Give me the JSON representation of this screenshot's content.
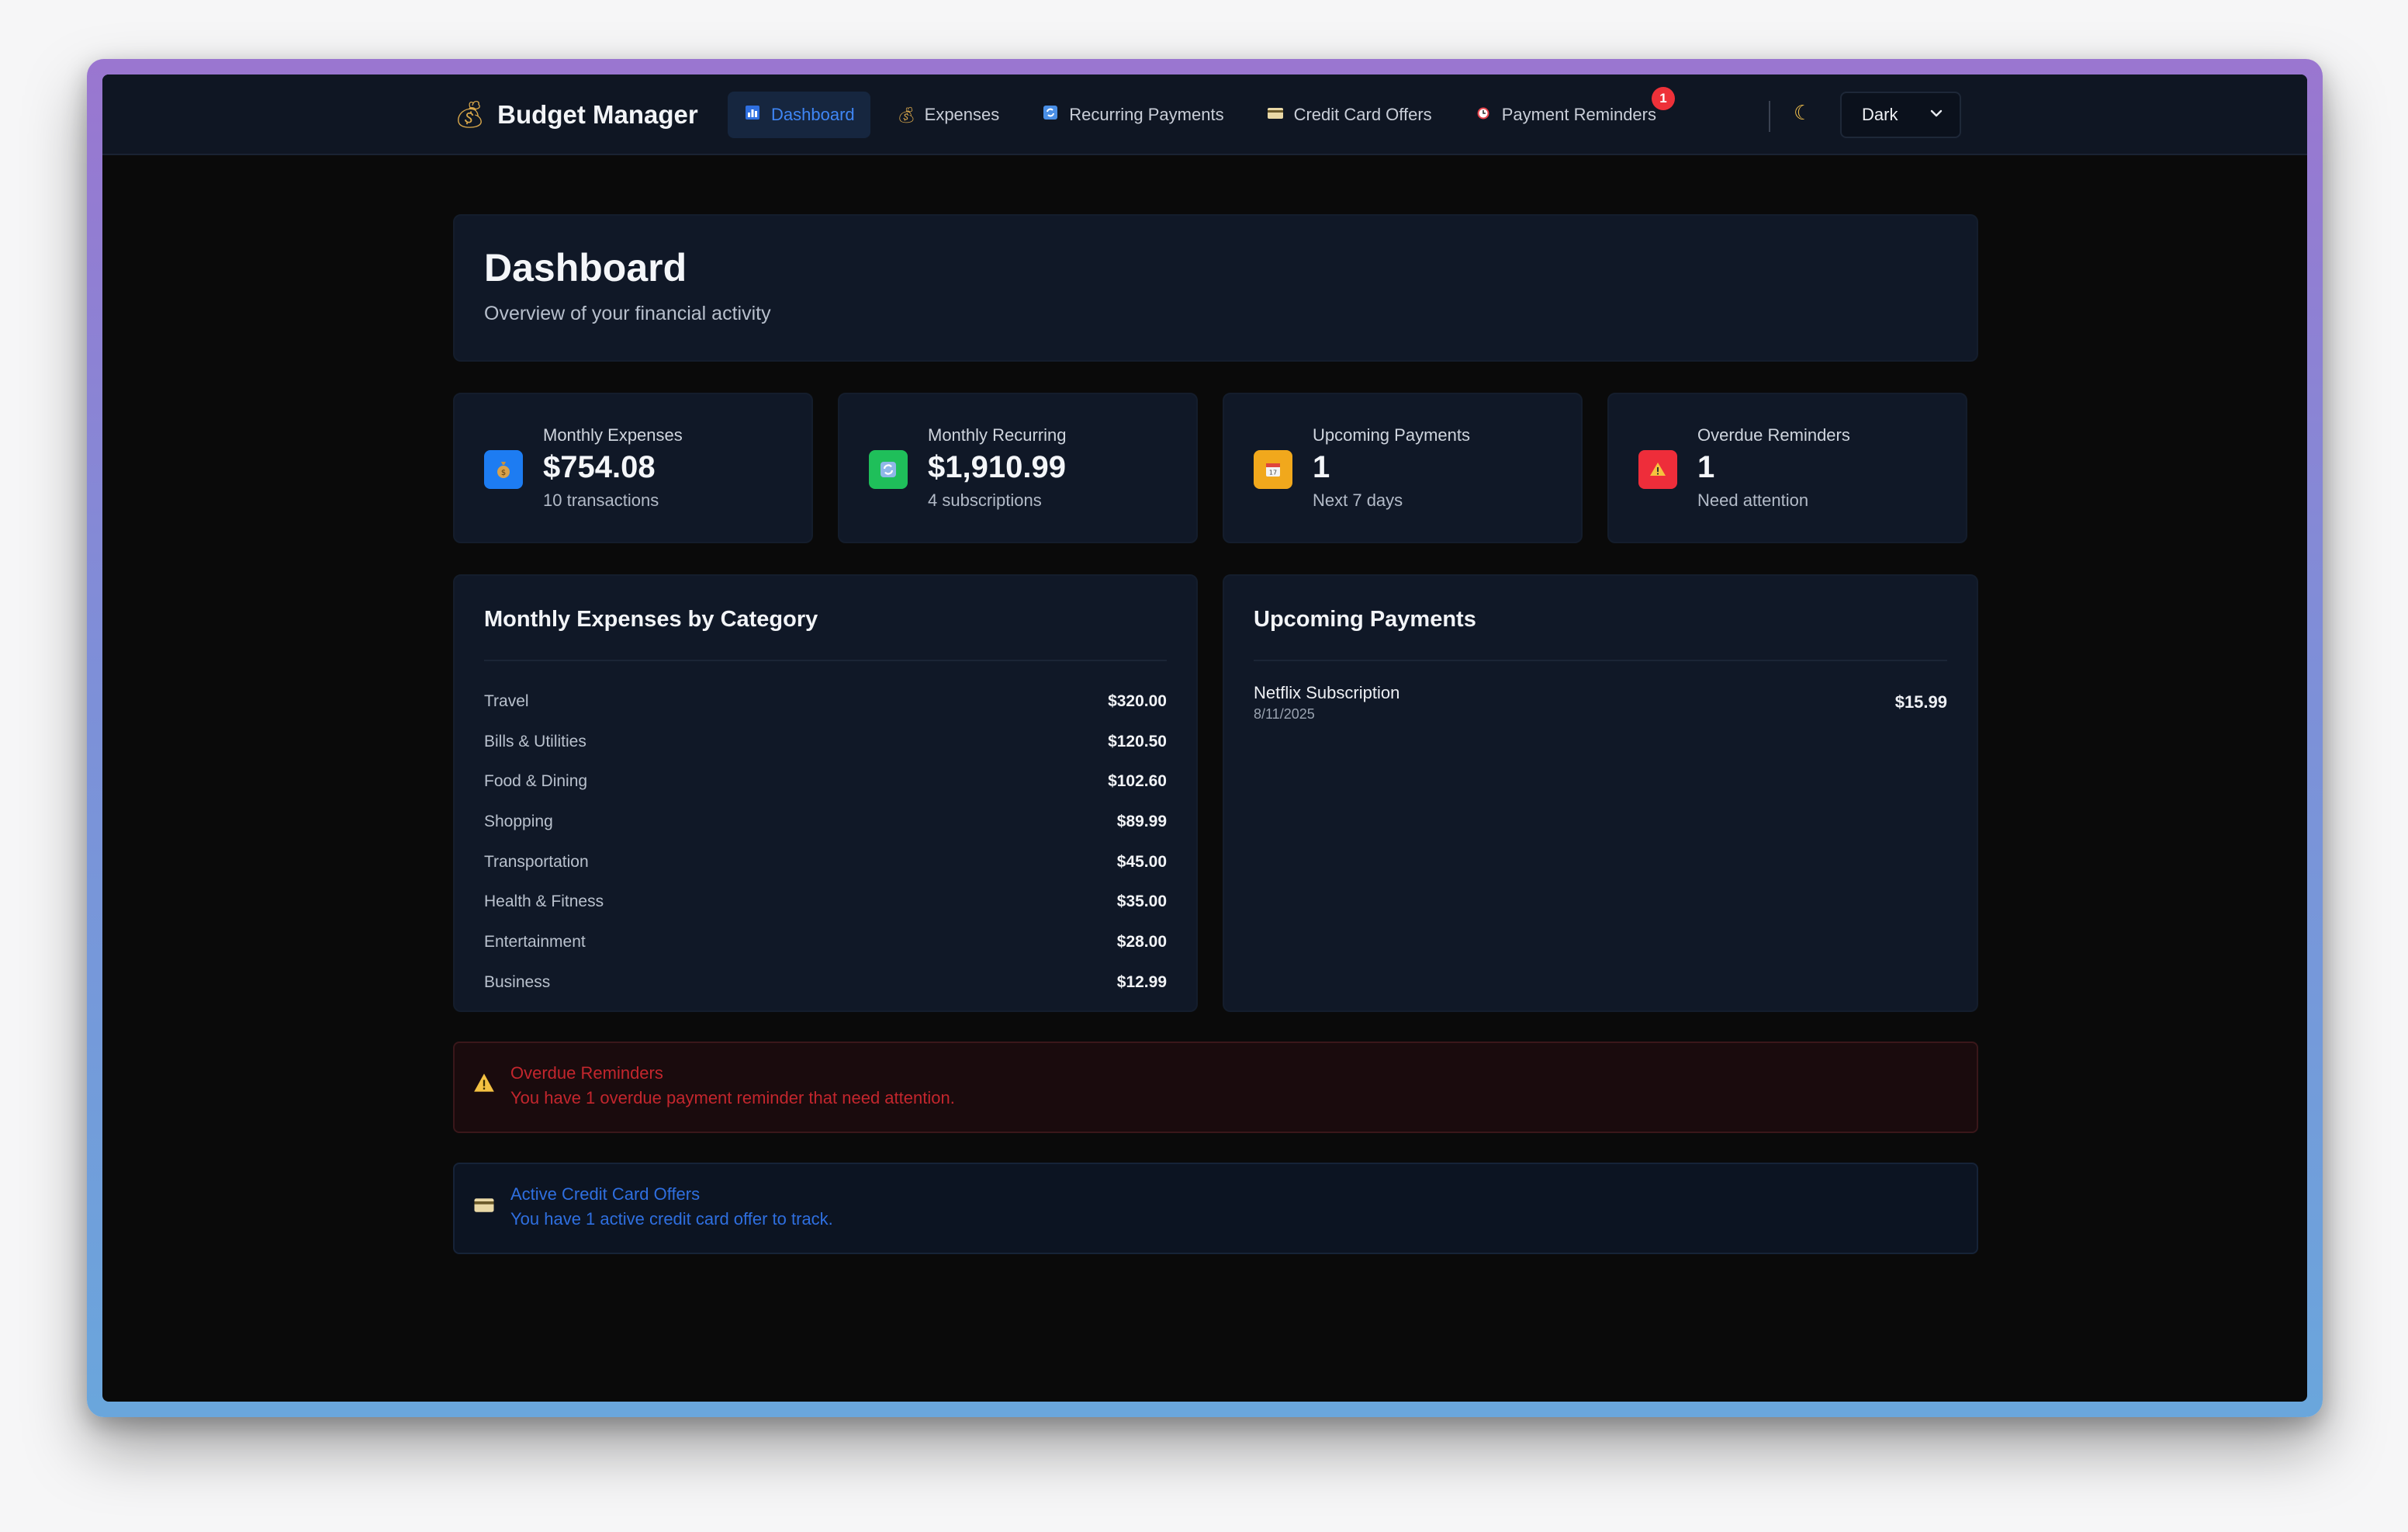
{
  "app": {
    "title": "Budget Manager",
    "icon": "money-bag-icon"
  },
  "nav": {
    "items": [
      {
        "label": "Dashboard",
        "icon": "chart-icon",
        "active": true
      },
      {
        "label": "Expenses",
        "icon": "money-bag-icon"
      },
      {
        "label": "Recurring Payments",
        "icon": "repeat-icon"
      },
      {
        "label": "Credit Card Offers",
        "icon": "credit-card-icon"
      },
      {
        "label": "Payment Reminders",
        "icon": "alarm-clock-icon",
        "badge": "1"
      }
    ],
    "theme_icon": "moon-icon",
    "theme_value": "Dark"
  },
  "header": {
    "title": "Dashboard",
    "subtitle": "Overview of your financial activity"
  },
  "stats": [
    {
      "label": "Monthly Expenses",
      "value": "$754.08",
      "sub": "10 transactions",
      "icon": "money-bag-icon",
      "color": "#1d7cf2"
    },
    {
      "label": "Monthly Recurring",
      "value": "$1,910.99",
      "sub": "4 subscriptions",
      "icon": "repeat-icon",
      "color": "#1fbf5a"
    },
    {
      "label": "Upcoming Payments",
      "value": "1",
      "sub": "Next 7 days",
      "icon": "calendar-icon",
      "color": "#f1a81c"
    },
    {
      "label": "Overdue Reminders",
      "value": "1",
      "sub": "Need attention",
      "icon": "warning-icon",
      "color": "#ee2d3a"
    }
  ],
  "categories": {
    "title": "Monthly Expenses by Category",
    "rows": [
      {
        "name": "Travel",
        "amount": "$320.00"
      },
      {
        "name": "Bills & Utilities",
        "amount": "$120.50"
      },
      {
        "name": "Food & Dining",
        "amount": "$102.60"
      },
      {
        "name": "Shopping",
        "amount": "$89.99"
      },
      {
        "name": "Transportation",
        "amount": "$45.00"
      },
      {
        "name": "Health & Fitness",
        "amount": "$35.00"
      },
      {
        "name": "Entertainment",
        "amount": "$28.00"
      },
      {
        "name": "Business",
        "amount": "$12.99"
      }
    ]
  },
  "upcoming": {
    "title": "Upcoming Payments",
    "items": [
      {
        "name": "Netflix Subscription",
        "date": "8/11/2025",
        "amount": "$15.99"
      }
    ]
  },
  "alerts": {
    "overdue": {
      "title": "Overdue Reminders",
      "text": "You have 1 overdue payment reminder that need attention.",
      "icon": "warning-icon"
    },
    "offers": {
      "title": "Active Credit Card Offers",
      "text": "You have 1 active credit card offer to track.",
      "icon": "credit-card-icon"
    }
  }
}
